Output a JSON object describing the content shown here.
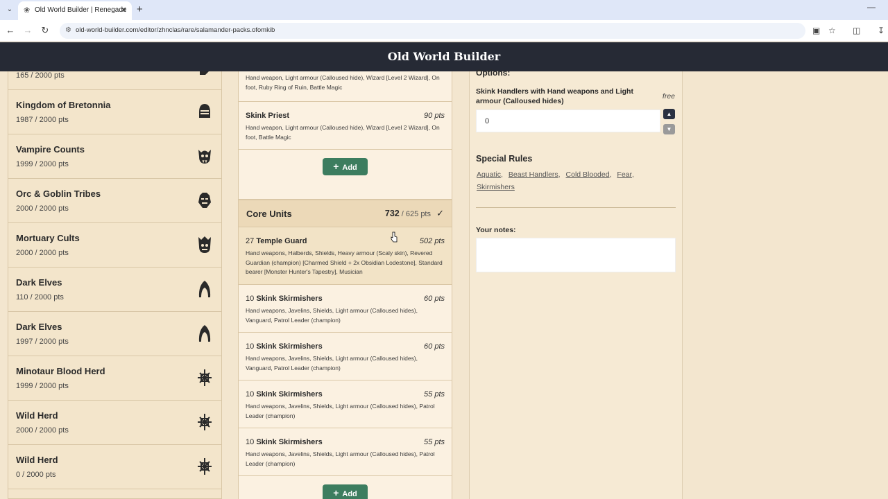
{
  "browser": {
    "tab_title": "Old World Builder | Renegade",
    "url": "old-world-builder.com/editor/zhnclas/rare/salamander-packs.ofomkib"
  },
  "app": {
    "title": "Old World Builder"
  },
  "sidebar": {
    "items": [
      {
        "name": "",
        "points": "165 / 2000 pts",
        "icon": "partial-icon"
      },
      {
        "name": "Kingdom of Bretonnia",
        "points": "1987 / 2000 pts",
        "icon": "helmet-icon"
      },
      {
        "name": "Vampire Counts",
        "points": "1999 / 2000 pts",
        "icon": "vampire-skull-icon"
      },
      {
        "name": "Orc & Goblin Tribes",
        "points": "2000 / 2000 pts",
        "icon": "orc-head-icon"
      },
      {
        "name": "Mortuary Cults",
        "points": "2000 / 2000 pts",
        "icon": "crowned-skull-icon"
      },
      {
        "name": "Dark Elves",
        "points": "110 / 2000 pts",
        "icon": "dark-elf-hood-icon"
      },
      {
        "name": "Dark Elves",
        "points": "1997 / 2000 pts",
        "icon": "dark-elf-hood-icon"
      },
      {
        "name": "Minotaur Blood Herd",
        "points": "1999 / 2000 pts",
        "icon": "beast-star-icon"
      },
      {
        "name": "Wild Herd",
        "points": "2000 / 2000 pts",
        "icon": "beast-star-icon"
      },
      {
        "name": "Wild Herd",
        "points": "0 / 2000 pts",
        "icon": "beast-star-icon"
      }
    ]
  },
  "units": {
    "top_partial_desc": "Hand weapon, Light armour (Calloused hide), Wizard [Level 2 Wizard], On foot, Ruby Ring of Ruin, Battle Magic",
    "skink_priest": {
      "name": "Skink Priest",
      "points": "90 pts",
      "desc": "Hand weapon, Light armour (Calloused hide), Wizard [Level 2 Wizard], On foot, Battle Magic"
    },
    "add_label": "Add",
    "core": {
      "title": "Core Units",
      "points_current": "732",
      "points_limit": "/ 625 pts",
      "check": "✓"
    },
    "core_list": [
      {
        "count": "27",
        "name": "Temple Guard",
        "points": "502 pts",
        "desc": "Hand weapons, Halberds, Shields, Heavy armour (Scaly skin), Revered Guardian (champion) [Charmed Shield + 2x Obsidian Lodestone], Standard bearer [Monster Hunter's Tapestry], Musician"
      },
      {
        "count": "10",
        "name": "Skink Skirmishers",
        "points": "60 pts",
        "desc": "Hand weapons, Javelins, Shields, Light armour (Calloused hides), Vanguard, Patrol Leader (champion)"
      },
      {
        "count": "10",
        "name": "Skink Skirmishers",
        "points": "60 pts",
        "desc": "Hand weapons, Javelins, Shields, Light armour (Calloused hides), Vanguard, Patrol Leader (champion)"
      },
      {
        "count": "10",
        "name": "Skink Skirmishers",
        "points": "55 pts",
        "desc": "Hand weapons, Javelins, Shields, Light armour (Calloused hides), Patrol Leader (champion)"
      },
      {
        "count": "10",
        "name": "Skink Skirmishers",
        "points": "55 pts",
        "desc": "Hand weapons, Javelins, Shields, Light armour (Calloused hides), Patrol Leader (champion)"
      }
    ]
  },
  "detail": {
    "options_heading": "Options:",
    "option_label": "Skink Handlers with Hand weapons and Light armour (Calloused hides)",
    "option_cost": "free",
    "option_value": "0",
    "special_rules_heading": "Special Rules",
    "special_rules": [
      "Aquatic",
      "Beast Handlers",
      "Cold Blooded",
      "Fear",
      "Skirmishers"
    ],
    "notes_label": "Your notes:"
  }
}
